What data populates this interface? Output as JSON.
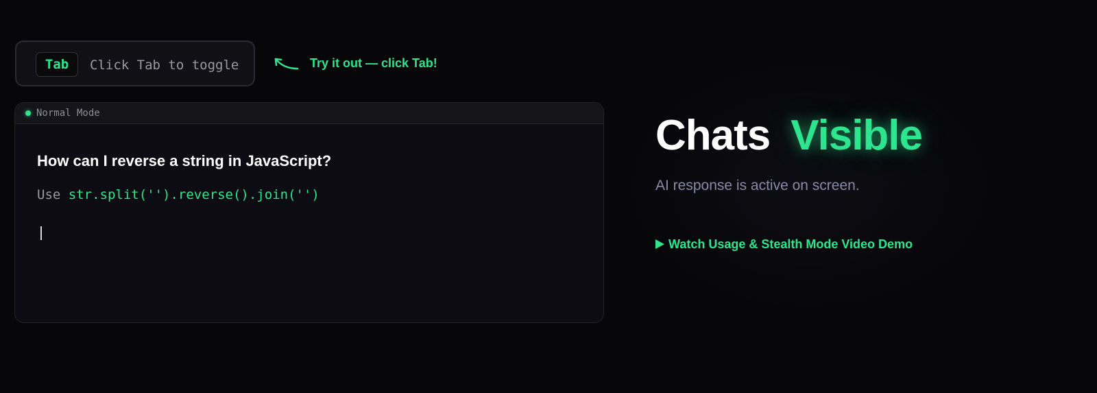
{
  "toggle": {
    "key_label": "Tab",
    "hint": "Click Tab to toggle",
    "try_hint": "Try it out — click Tab!"
  },
  "panel": {
    "mode_label": "Normal Mode",
    "question": "How can I reverse a string in JavaScript?",
    "answer_prefix": "Use ",
    "answer_code": "str.split('').reverse().join('')"
  },
  "status": {
    "title_word": "Chats",
    "title_status": "Visible",
    "subtitle": "AI response is active on screen.",
    "demo_link": "Watch Usage & Stealth Mode Video Demo"
  },
  "colors": {
    "accent": "#2ee58f",
    "background": "#07070a",
    "panel": "#0d0c12",
    "muted_text": "#9a9aa6"
  },
  "icons": {
    "arrow": "curved-arrow-icon",
    "status": "status-dot-icon",
    "play": "play-icon"
  }
}
